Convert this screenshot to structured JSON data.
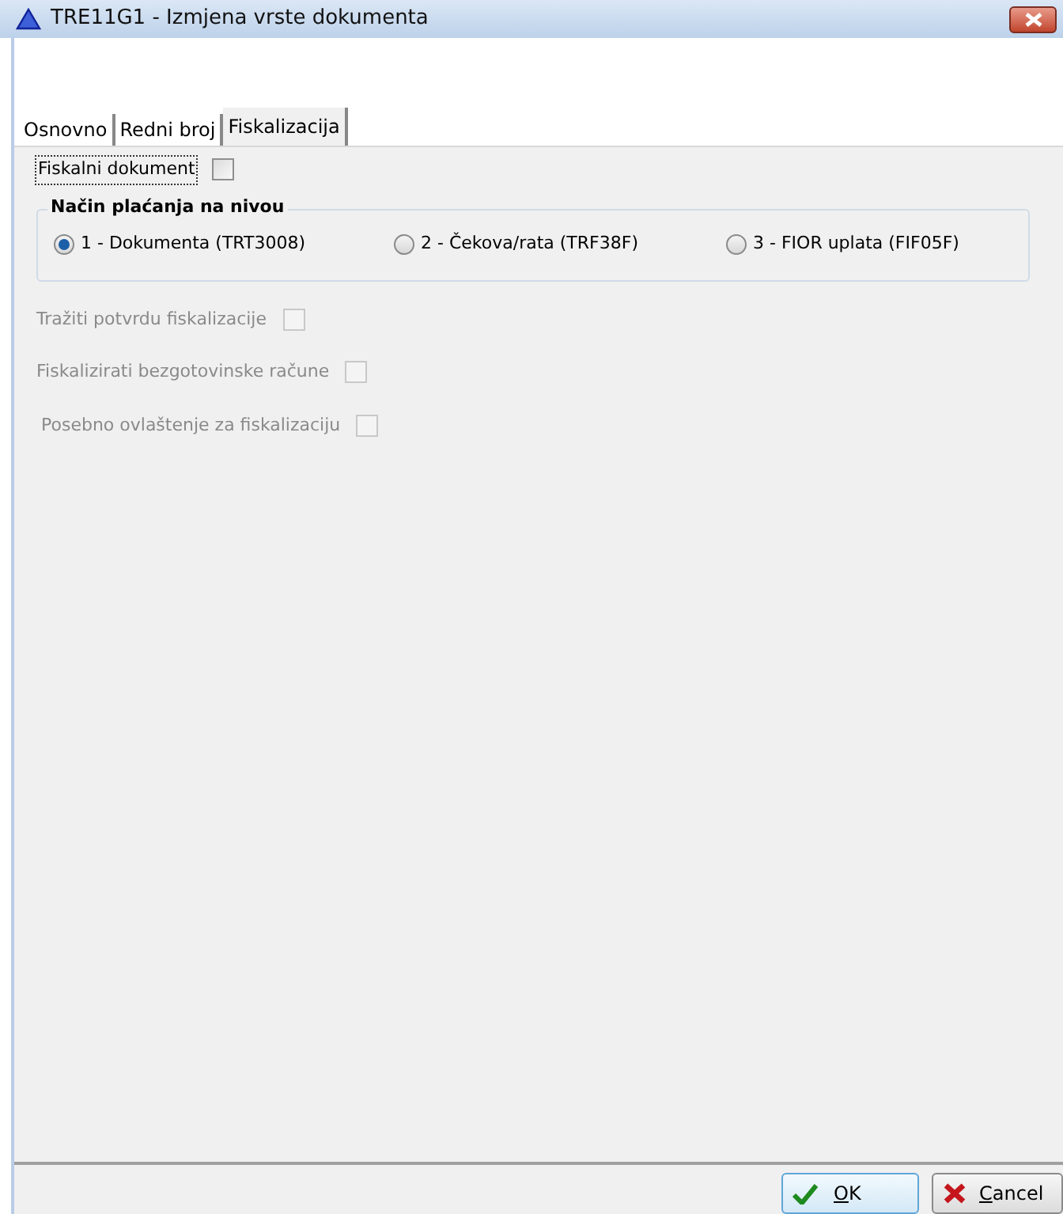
{
  "window": {
    "title": "TRE11G1 - Izmjena vrste dokumenta"
  },
  "tabs": [
    {
      "label": "Osnovno",
      "selected": false
    },
    {
      "label": "Redni broj",
      "selected": false
    },
    {
      "label": "Fiskalizacija",
      "selected": true
    }
  ],
  "fiscal_document": {
    "label": "Fiskalni dokument",
    "checked": false,
    "focused": true
  },
  "payment_group": {
    "title": "Način plaćanja na nivou",
    "options": [
      {
        "label": "1 - Dokumenta (TRT3008)",
        "selected": true
      },
      {
        "label": "2 - Čekova/rata (TRF38F)",
        "selected": false
      },
      {
        "label": "3 - FIOR uplata (FIF05F)",
        "selected": false
      }
    ]
  },
  "options": [
    {
      "label": "Tražiti potvrdu fiskalizacije",
      "checked": false,
      "disabled": true
    },
    {
      "label": "Fiskalizirati bezgotovinske račune",
      "checked": false,
      "disabled": true
    },
    {
      "label": "Posebno ovlaštenje za fiskalizaciju",
      "checked": false,
      "disabled": true
    }
  ],
  "buttons": [
    {
      "label": "OK",
      "kind": "ok"
    },
    {
      "label": "Cancel",
      "kind": "cancel"
    }
  ]
}
